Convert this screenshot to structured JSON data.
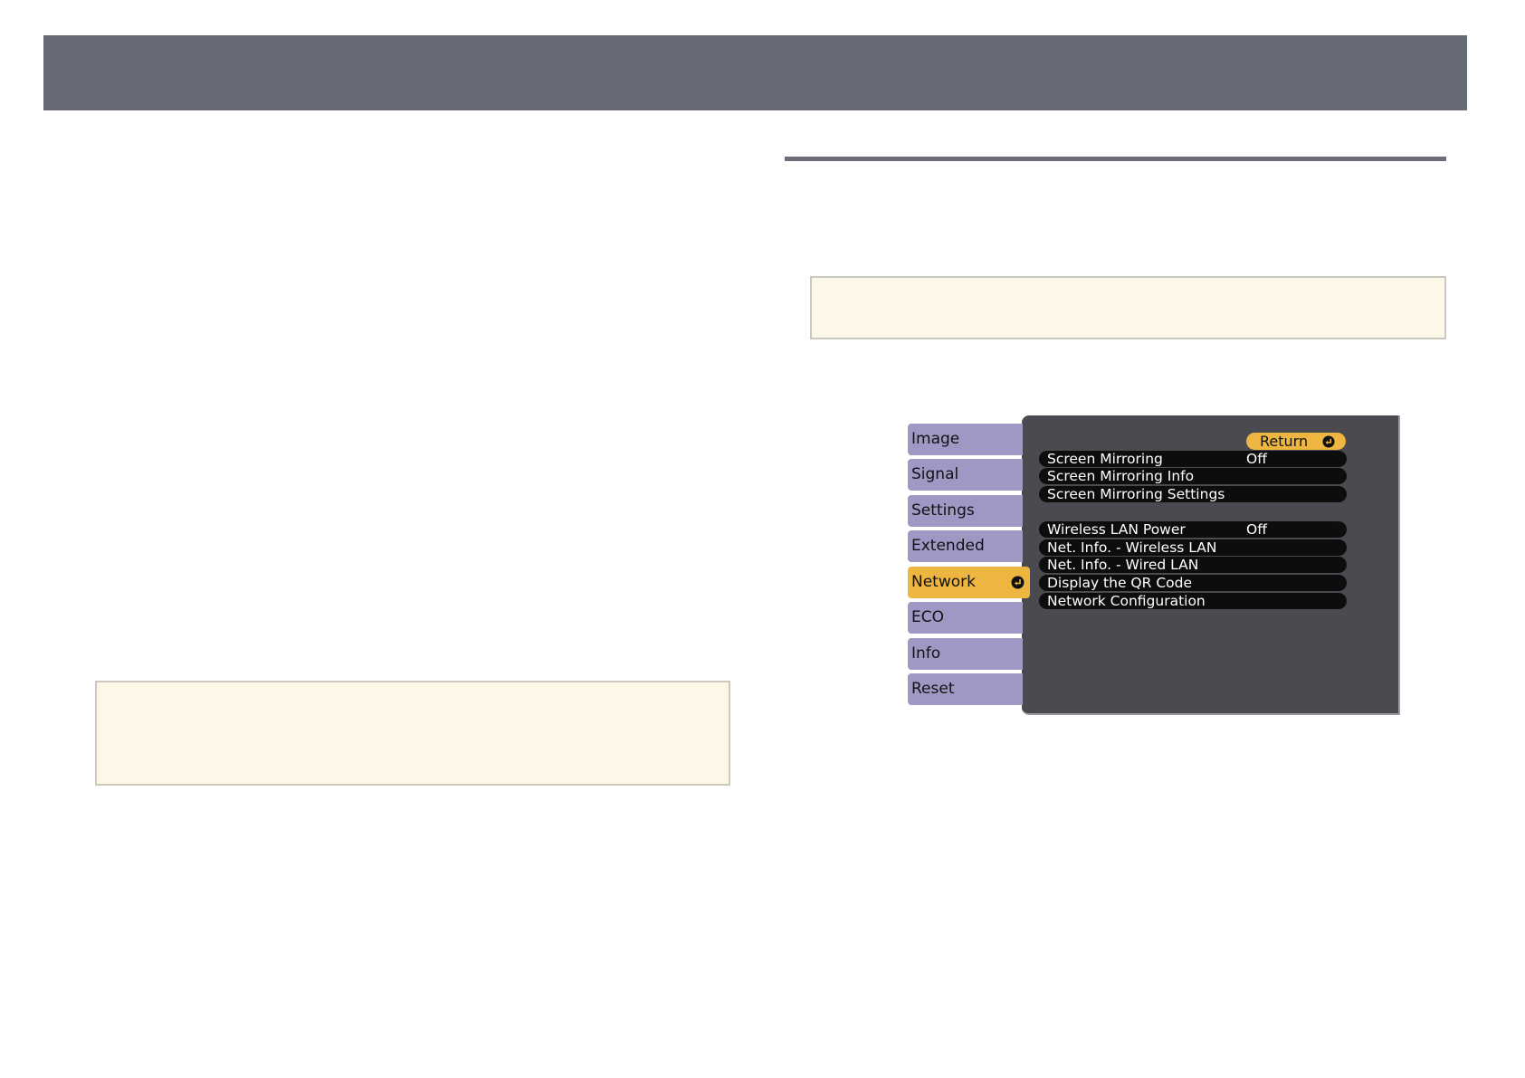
{
  "colors": {
    "header_bar": "#666a74",
    "note_background": "#fdf7e7",
    "menu_tab": "#9f98c4",
    "menu_tab_active": "#eeb640",
    "menu_panel": "#4a4a50",
    "menu_row": "#0d0d0d"
  },
  "menu": {
    "tabs": [
      {
        "label": "Image",
        "icon": ""
      },
      {
        "label": "Signal",
        "icon": ""
      },
      {
        "label": "Settings",
        "icon": ""
      },
      {
        "label": "Extended",
        "icon": ""
      },
      {
        "label": "Network",
        "icon": "enter-icon",
        "selected": true
      },
      {
        "label": "ECO",
        "icon": ""
      },
      {
        "label": "Info",
        "icon": ""
      },
      {
        "label": "Reset",
        "icon": ""
      }
    ],
    "return_label": "Return",
    "return_icon": "enter-icon",
    "items": [
      {
        "label": "Screen Mirroring",
        "value": "Off"
      },
      {
        "label": "Screen Mirroring Info",
        "value": ""
      },
      {
        "label": "Screen Mirroring Settings",
        "value": ""
      },
      {
        "label": "Wireless LAN Power",
        "value": "Off"
      },
      {
        "label": "Net. Info. - Wireless LAN",
        "value": ""
      },
      {
        "label": "Net. Info. - Wired LAN",
        "value": ""
      },
      {
        "label": "Display the QR Code",
        "value": ""
      },
      {
        "label": "Network Configuration",
        "value": ""
      }
    ]
  }
}
